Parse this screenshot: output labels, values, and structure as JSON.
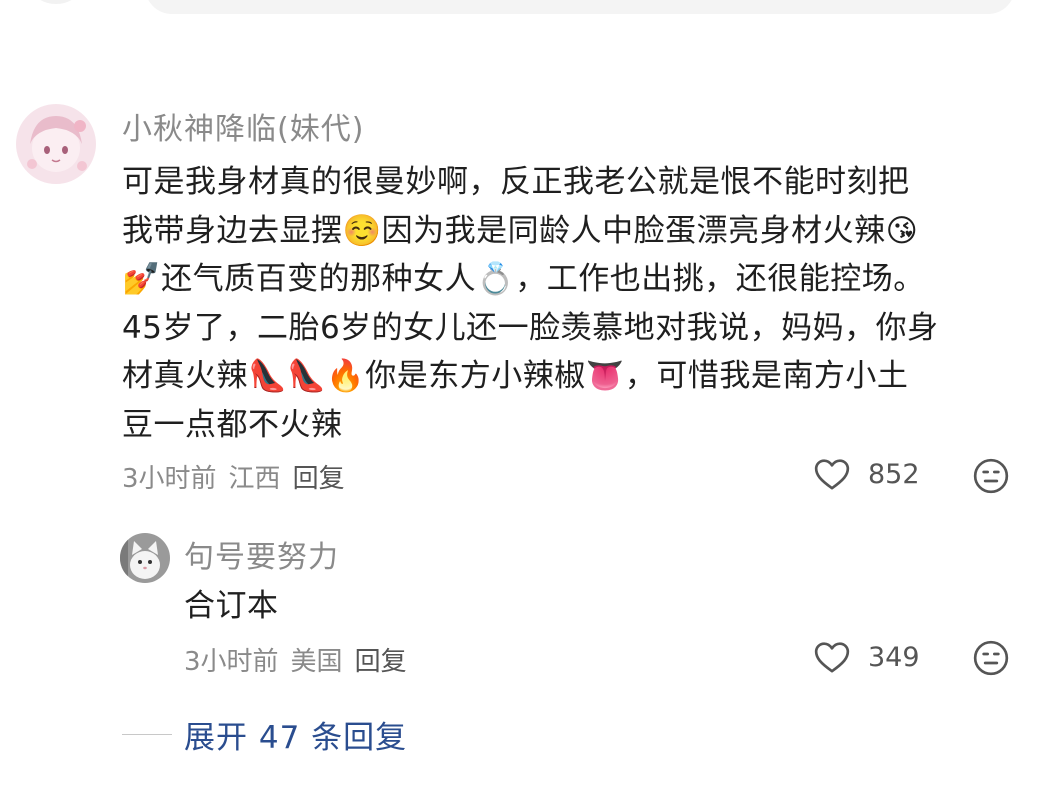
{
  "main_comment": {
    "username": "小秋神降临(妹代)",
    "lines": [
      "可是我身材真的很曼妙啊，反正我老公就是恨不能时刻把",
      "我带身边去显摆☺️因为我是同龄人中脸蛋漂亮身材火辣😘",
      "💅还气质百变的那种女人💍，工作也出挑，还很能控场。",
      "45岁了，二胎6岁的女儿还一脸羡慕地对我说，妈妈，你身",
      "材真火辣👠👠🔥你是东方小辣椒👅，可惜我是南方小土",
      "豆一点都不火辣"
    ],
    "time": "3小时前",
    "location": "江西",
    "reply_label": "回复",
    "likes": "852",
    "avatar_icon": "anime-girl-avatar"
  },
  "reply_comment": {
    "username": "句号要努力",
    "text": "合订本",
    "time": "3小时前",
    "location": "美国",
    "reply_label": "回复",
    "likes": "349",
    "avatar_icon": "white-cat-avatar"
  },
  "expand": {
    "label": "展开 47 条回复"
  },
  "icons": {
    "like": "heart-outline-icon",
    "dislike": "meh-face-icon"
  },
  "colors": {
    "username": "#8a8a8a",
    "body": "#1f1f1f",
    "expand_link": "#2a4d8f",
    "icon": "#555555"
  }
}
